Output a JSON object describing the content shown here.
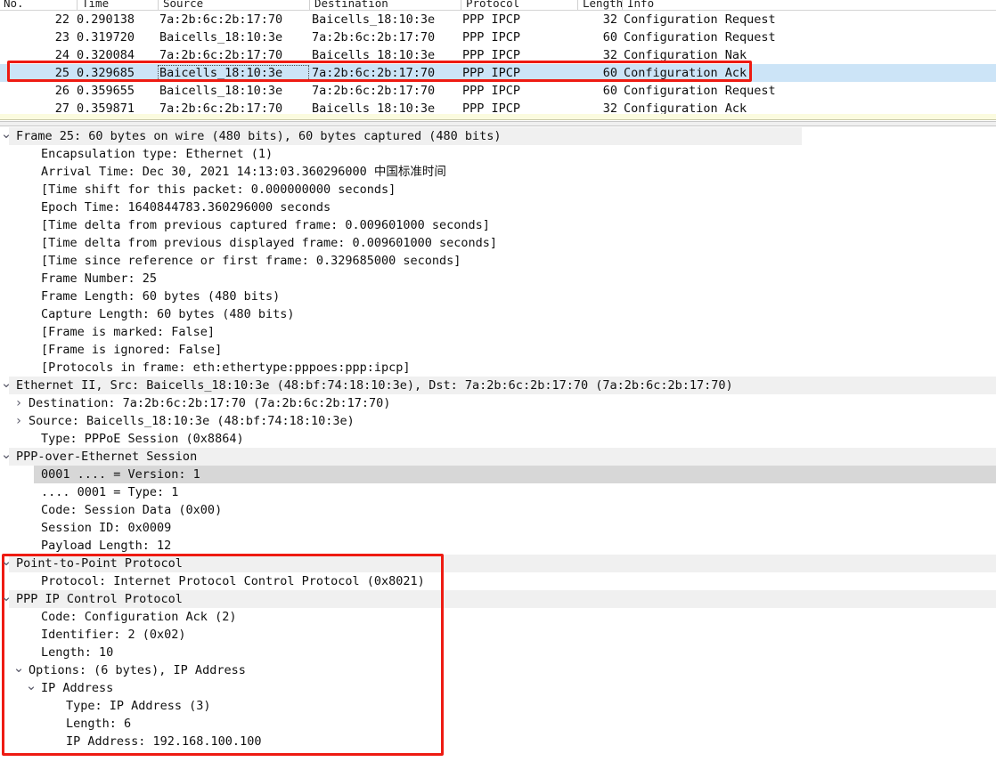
{
  "packet_list": {
    "columns": [
      {
        "key": "no",
        "label": "No."
      },
      {
        "key": "time",
        "label": "Time"
      },
      {
        "key": "source",
        "label": "Source"
      },
      {
        "key": "destination",
        "label": "Destination"
      },
      {
        "key": "protocol",
        "label": "Protocol"
      },
      {
        "key": "length",
        "label": "Length"
      },
      {
        "key": "info",
        "label": "Info"
      }
    ],
    "rows": [
      {
        "no": "22",
        "time": "0.290138",
        "source": "7a:2b:6c:2b:17:70",
        "destination": "Baicells_18:10:3e",
        "protocol": "PPP IPCP",
        "length": "32",
        "info": "Configuration Request",
        "selected": false
      },
      {
        "no": "23",
        "time": "0.319720",
        "source": "Baicells_18:10:3e",
        "destination": "7a:2b:6c:2b:17:70",
        "protocol": "PPP IPCP",
        "length": "60",
        "info": "Configuration Request",
        "selected": false
      },
      {
        "no": "24",
        "time": "0.320084",
        "source": "7a:2b:6c:2b:17:70",
        "destination": "Baicells_18:10:3e",
        "protocol": "PPP IPCP",
        "length": "32",
        "info": "Configuration Nak",
        "selected": false
      },
      {
        "no": "25",
        "time": "0.329685",
        "source": "Baicells_18:10:3e",
        "destination": "7a:2b:6c:2b:17:70",
        "protocol": "PPP IPCP",
        "length": "60",
        "info": "Configuration Ack",
        "selected": true
      },
      {
        "no": "26",
        "time": "0.359655",
        "source": "Baicells_18:10:3e",
        "destination": "7a:2b:6c:2b:17:70",
        "protocol": "PPP IPCP",
        "length": "60",
        "info": "Configuration Request",
        "selected": false
      },
      {
        "no": "27",
        "time": "0.359871",
        "source": "7a:2b:6c:2b:17:70",
        "destination": "Baicells_18:10:3e",
        "protocol": "PPP IPCP",
        "length": "32",
        "info": "Configuration Ack",
        "selected": false
      }
    ]
  },
  "detail_tree": {
    "rows": [
      {
        "indent": 0,
        "twisty": "v",
        "text": "Frame 25: 60 bytes on wire (480 bits), 60 bytes captured (480 bits)",
        "shade": "light",
        "shade_width": 890
      },
      {
        "indent": 2,
        "twisty": "",
        "text": "Encapsulation type: Ethernet (1)",
        "shade": "none"
      },
      {
        "indent": 2,
        "twisty": "",
        "text": "Arrival Time: Dec 30, 2021 14:13:03.360296000 中国标准时间",
        "shade": "none"
      },
      {
        "indent": 2,
        "twisty": "",
        "text": "[Time shift for this packet: 0.000000000 seconds]",
        "shade": "none"
      },
      {
        "indent": 2,
        "twisty": "",
        "text": "Epoch Time: 1640844783.360296000 seconds",
        "shade": "none"
      },
      {
        "indent": 2,
        "twisty": "",
        "text": "[Time delta from previous captured frame: 0.009601000 seconds]",
        "shade": "none"
      },
      {
        "indent": 2,
        "twisty": "",
        "text": "[Time delta from previous displayed frame: 0.009601000 seconds]",
        "shade": "none"
      },
      {
        "indent": 2,
        "twisty": "",
        "text": "[Time since reference or first frame: 0.329685000 seconds]",
        "shade": "none"
      },
      {
        "indent": 2,
        "twisty": "",
        "text": "Frame Number: 25",
        "shade": "none"
      },
      {
        "indent": 2,
        "twisty": "",
        "text": "Frame Length: 60 bytes (480 bits)",
        "shade": "none"
      },
      {
        "indent": 2,
        "twisty": "",
        "text": "Capture Length: 60 bytes (480 bits)",
        "shade": "none"
      },
      {
        "indent": 2,
        "twisty": "",
        "text": "[Frame is marked: False]",
        "shade": "none"
      },
      {
        "indent": 2,
        "twisty": "",
        "text": "[Frame is ignored: False]",
        "shade": "none"
      },
      {
        "indent": 2,
        "twisty": "",
        "text": "[Protocols in frame: eth:ethertype:pppoes:ppp:ipcp]",
        "shade": "none"
      },
      {
        "indent": 0,
        "twisty": "v",
        "text": "Ethernet II, Src: Baicells_18:10:3e (48:bf:74:18:10:3e), Dst: 7a:2b:6c:2b:17:70 (7a:2b:6c:2b:17:70)",
        "shade": "light",
        "shade_width": 1118
      },
      {
        "indent": 1,
        "twisty": ">",
        "text": "Destination: 7a:2b:6c:2b:17:70 (7a:2b:6c:2b:17:70)",
        "shade": "none"
      },
      {
        "indent": 1,
        "twisty": ">",
        "text": "Source: Baicells_18:10:3e (48:bf:74:18:10:3e)",
        "shade": "none"
      },
      {
        "indent": 2,
        "twisty": "",
        "text": "Type: PPPoE Session (0x8864)",
        "shade": "none"
      },
      {
        "indent": 0,
        "twisty": "v",
        "text": "PPP-over-Ethernet Session",
        "shade": "light",
        "shade_width": 1118
      },
      {
        "indent": 2,
        "twisty": "",
        "text": "0001 .... = Version: 1",
        "shade": "dark",
        "shade_start": 38,
        "shade_width": 1080
      },
      {
        "indent": 2,
        "twisty": "",
        "text": ".... 0001 = Type: 1",
        "shade": "none"
      },
      {
        "indent": 2,
        "twisty": "",
        "text": "Code: Session Data (0x00)",
        "shade": "none"
      },
      {
        "indent": 2,
        "twisty": "",
        "text": "Session ID: 0x0009",
        "shade": "none"
      },
      {
        "indent": 2,
        "twisty": "",
        "text": "Payload Length: 12",
        "shade": "none"
      },
      {
        "indent": 0,
        "twisty": "v",
        "text": "Point-to-Point Protocol",
        "shade": "light",
        "shade_width": 1118
      },
      {
        "indent": 2,
        "twisty": "",
        "text": "Protocol: Internet Protocol Control Protocol (0x8021)",
        "shade": "none"
      },
      {
        "indent": 0,
        "twisty": "v",
        "text": "PPP IP Control Protocol",
        "shade": "light",
        "shade_width": 1118
      },
      {
        "indent": 2,
        "twisty": "",
        "text": "Code: Configuration Ack (2)",
        "shade": "none"
      },
      {
        "indent": 2,
        "twisty": "",
        "text": "Identifier: 2 (0x02)",
        "shade": "none"
      },
      {
        "indent": 2,
        "twisty": "",
        "text": "Length: 10",
        "shade": "none"
      },
      {
        "indent": 1,
        "twisty": "v",
        "text": "Options: (6 bytes), IP Address",
        "shade": "none"
      },
      {
        "indent": 2,
        "twisty": "v",
        "text": "IP Address",
        "shade": "none"
      },
      {
        "indent": 4,
        "twisty": "",
        "text": "Type: IP Address (3)",
        "shade": "none"
      },
      {
        "indent": 4,
        "twisty": "",
        "text": "Length: 6",
        "shade": "none"
      },
      {
        "indent": 4,
        "twisty": "",
        "text": "IP Address: 192.168.100.100",
        "shade": "none"
      }
    ]
  },
  "annotations": {
    "highlight_color": "#ee1b12",
    "selection_color": "#cce4f7",
    "row_shade_light": "#f0f0f0",
    "row_shade_dark": "#d7d7d7"
  }
}
